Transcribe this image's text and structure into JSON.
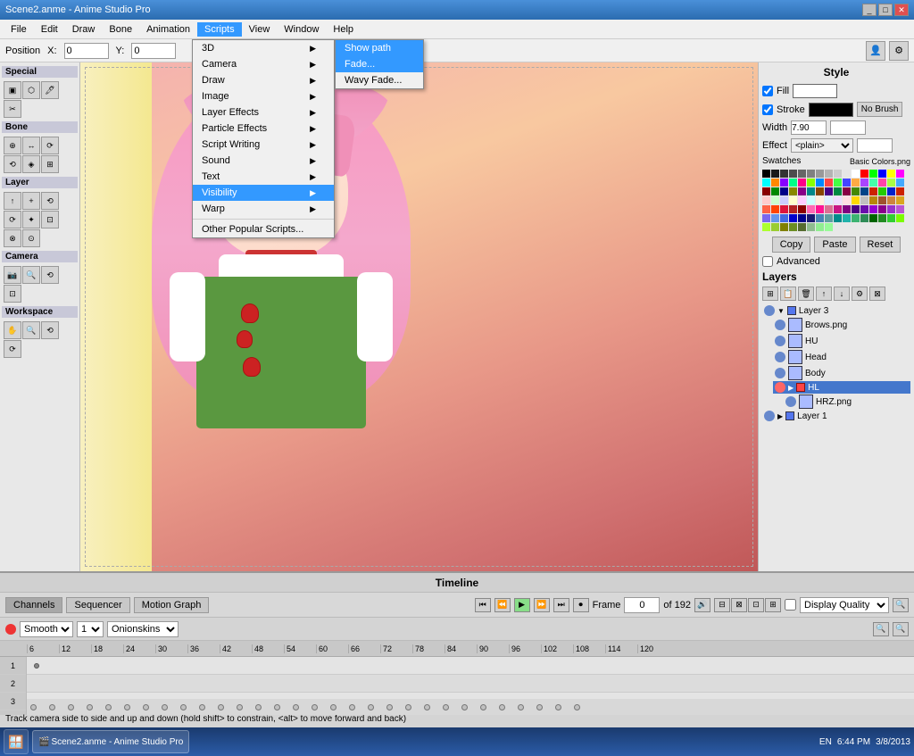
{
  "window": {
    "title": "Scene2.anme - Anime Studio Pro",
    "controls": [
      "_",
      "□",
      "✕"
    ]
  },
  "menubar": {
    "items": [
      "File",
      "Edit",
      "Draw",
      "Bone",
      "Animation",
      "Scripts",
      "View",
      "Window",
      "Help"
    ]
  },
  "toolbar": {
    "position_label": "Position",
    "x_label": "X:",
    "x_value": "0",
    "y_label": "Y:",
    "y_value": "0"
  },
  "tools": {
    "special_label": "Special",
    "bone_label": "Bone",
    "layer_label": "Layer",
    "camera_label": "Camera",
    "workspace_label": "Workspace"
  },
  "scripts_menu": {
    "items": [
      {
        "label": "3D",
        "has_sub": true
      },
      {
        "label": "Camera",
        "has_sub": true
      },
      {
        "label": "Draw",
        "has_sub": true
      },
      {
        "label": "Image",
        "has_sub": true
      },
      {
        "label": "Layer Effects",
        "has_sub": true
      },
      {
        "label": "Particle Effects",
        "has_sub": true
      },
      {
        "label": "Script Writing",
        "has_sub": true
      },
      {
        "label": "Sound",
        "has_sub": true
      },
      {
        "label": "Text",
        "has_sub": true
      },
      {
        "label": "Visibility",
        "has_sub": true,
        "highlighted": true
      },
      {
        "label": "Warp",
        "has_sub": true
      },
      {
        "label": "Other Popular Scripts...",
        "has_sub": false
      }
    ]
  },
  "visibility_submenu": {
    "items": [
      {
        "label": "Fade...",
        "highlighted": true
      },
      {
        "label": "Wavy Fade..."
      }
    ]
  },
  "show_path_item": "Show path",
  "style": {
    "title": "Style",
    "fill_label": "Fill",
    "stroke_label": "Stroke",
    "width_label": "Width",
    "width_value": "7.90",
    "effect_label": "Effect",
    "effect_value": "<plain>",
    "no_brush_label": "No Brush",
    "swatches_label": "Swatches",
    "swatches_file": "Basic Colors.png",
    "copy_label": "Copy",
    "paste_label": "Paste",
    "reset_label": "Reset",
    "advanced_label": "Advanced"
  },
  "layers": {
    "title": "Layers",
    "items": [
      {
        "name": "Layer 3",
        "level": 0,
        "color": "#5588ff",
        "active": false
      },
      {
        "name": "Brows.png",
        "level": 1,
        "color": "#88aaff",
        "active": false
      },
      {
        "name": "HU",
        "level": 1,
        "color": "#88aaff",
        "active": false
      },
      {
        "name": "Head",
        "level": 1,
        "color": "#88aaff",
        "active": false
      },
      {
        "name": "Body",
        "level": 1,
        "color": "#88aaff",
        "active": false
      },
      {
        "name": "HL",
        "level": 1,
        "color": "#ff4444",
        "active": true
      },
      {
        "name": "HRZ.png",
        "level": 2,
        "color": "#88aaff",
        "active": false
      },
      {
        "name": "Layer 1",
        "level": 0,
        "color": "#5588ff",
        "active": false
      }
    ]
  },
  "timeline": {
    "title": "Timeline",
    "tabs": [
      "Channels",
      "Sequencer",
      "Motion Graph"
    ],
    "smooth_label": "Smooth",
    "onionskins_label": "Onionskins",
    "frame_label": "Frame",
    "frame_value": "0",
    "of_label": "of",
    "total_frames": "192",
    "display_quality_label": "Display Quality",
    "ruler_ticks": [
      "6",
      "12",
      "18",
      "24",
      "30",
      "36",
      "42",
      "48",
      "54",
      "60",
      "66",
      "72",
      "78",
      "84",
      "90",
      "96",
      "102",
      "108",
      "114",
      "120"
    ]
  },
  "statusbar": {
    "text": "Track camera side to side and up and down (hold shift> to constrain, <alt> to move forward and back)"
  },
  "taskbar": {
    "time": "6:44 PM",
    "date": "3/8/2013",
    "language": "EN"
  },
  "swatches": {
    "colors": [
      "#000000",
      "#1a1a1a",
      "#333333",
      "#4d4d4d",
      "#666666",
      "#808080",
      "#999999",
      "#b3b3b3",
      "#cccccc",
      "#e6e6e6",
      "#ffffff",
      "#ff0000",
      "#00ff00",
      "#0000ff",
      "#ffff00",
      "#ff00ff",
      "#00ffff",
      "#ff8800",
      "#8800ff",
      "#00ff88",
      "#ff0088",
      "#88ff00",
      "#0088ff",
      "#ff4444",
      "#44ff44",
      "#4444ff",
      "#ffaa44",
      "#aa44ff",
      "#44ffaa",
      "#ff44aa",
      "#aaff44",
      "#44aaff",
      "#880000",
      "#008800",
      "#000088",
      "#888800",
      "#880088",
      "#008888",
      "#884400",
      "#440088",
      "#008844",
      "#880044",
      "#448800",
      "#004488",
      "#cc2200",
      "#22cc00",
      "#0022cc",
      "#cc2200",
      "#ffcccc",
      "#ccffcc",
      "#ccccff",
      "#ffffcc",
      "#ffccff",
      "#ccffff",
      "#ffeedd",
      "#ddeeff",
      "#eeddff",
      "#ffdde3",
      "#ffd700",
      "#c0c0c0",
      "#b8860b",
      "#a0522d",
      "#cd853f",
      "#daa520",
      "#ff6347",
      "#ff4500",
      "#dc143c",
      "#b22222",
      "#8b0000",
      "#ff69b4",
      "#ff1493",
      "#db7093",
      "#c71585",
      "#800080",
      "#4b0082",
      "#6a0dad",
      "#9400d3",
      "#8b008b",
      "#9932cc",
      "#ba55d3",
      "#7b68ee",
      "#6495ed",
      "#4169e1",
      "#0000cd",
      "#00008b",
      "#191970",
      "#4682b4",
      "#5f9ea0",
      "#008b8b",
      "#20b2aa",
      "#3cb371",
      "#2e8b57",
      "#006400",
      "#228b22",
      "#32cd32",
      "#7cfc00",
      "#adff2f",
      "#9acd32",
      "#808000",
      "#6b8e23",
      "#556b2f",
      "#8fbc8f",
      "#90ee90",
      "#98fb98"
    ]
  }
}
